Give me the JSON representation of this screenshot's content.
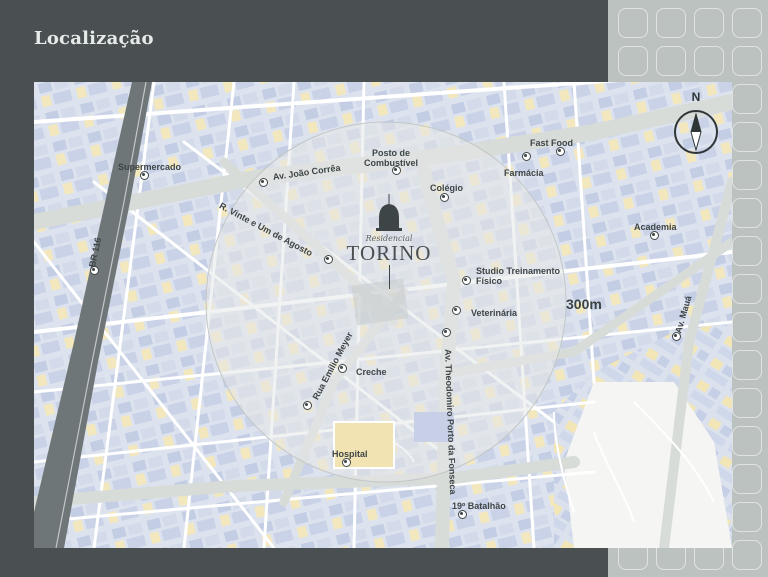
{
  "header": {
    "title": "Localização"
  },
  "map": {
    "development": {
      "kicker": "Residencial",
      "name": "TORINO"
    },
    "radius_label": "300m",
    "compass_label": "N",
    "pois": [
      {
        "id": "supermercado",
        "label": "Supermercado"
      },
      {
        "id": "posto",
        "label": "Posto de\nCombustível"
      },
      {
        "id": "fast-food",
        "label": "Fast Food"
      },
      {
        "id": "farmacia",
        "label": "Farmácia"
      },
      {
        "id": "colegio",
        "label": "Colégio"
      },
      {
        "id": "academia",
        "label": "Academia"
      },
      {
        "id": "studio",
        "label": "Studio Treinamento\nFísico"
      },
      {
        "id": "veterinaria",
        "label": "Veterinária"
      },
      {
        "id": "creche",
        "label": "Creche"
      },
      {
        "id": "hospital",
        "label": "Hospital"
      },
      {
        "id": "batalhao",
        "label": "19º Batalhão"
      }
    ],
    "streets": [
      {
        "id": "br116",
        "label": "BR 116"
      },
      {
        "id": "joao-correa",
        "label": "Av. João Corrêa"
      },
      {
        "id": "vinte-um-agosto",
        "label": "R. Vinte e Um de Agosto"
      },
      {
        "id": "emilio-meyer",
        "label": "Rua Emílio Meyer"
      },
      {
        "id": "theodomiro",
        "label": "Av. Theodomiro Porto da Fonseca"
      },
      {
        "id": "maua",
        "label": "Av. Mauá"
      }
    ]
  },
  "colors": {
    "frame_background": "#4a5052",
    "tile_panel": "#bcc2c0",
    "block_blue": "#c9d3e8",
    "block_yellow": "#f3e5b8",
    "road": "#ffffff",
    "ink": "#3e4547"
  }
}
